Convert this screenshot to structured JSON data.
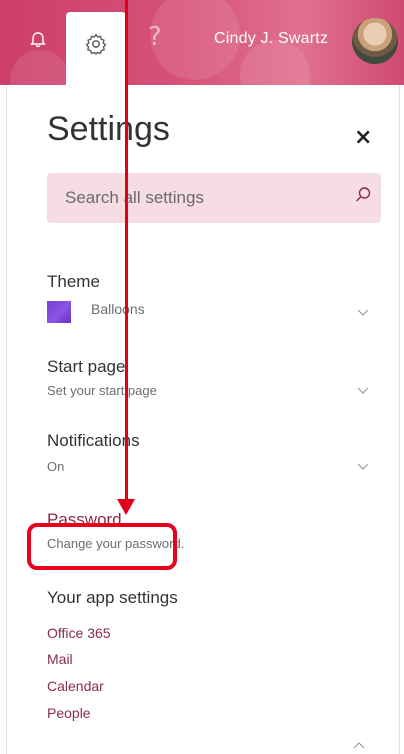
{
  "topbar": {
    "user_name": "Cindy J. Swartz",
    "help_glyph": "?",
    "icons": [
      "bell-icon",
      "gear-icon",
      "help-icon"
    ],
    "accent_color": "#d6527a"
  },
  "settings": {
    "title": "Settings",
    "close_glyph": "×",
    "search": {
      "placeholder": "Search all settings",
      "value": ""
    },
    "theme": {
      "label": "Theme",
      "value": "Balloons"
    },
    "start_page": {
      "label": "Start page",
      "subtitle": "Set your start page"
    },
    "notifications": {
      "label": "Notifications",
      "value": "On"
    },
    "password": {
      "label": "Password",
      "subtitle": "Change your password."
    },
    "app_settings": {
      "label": "Your app settings",
      "items": [
        "Office 365",
        "Mail",
        "Calendar",
        "People"
      ]
    }
  },
  "annotation": {
    "color": "#e8001d"
  }
}
